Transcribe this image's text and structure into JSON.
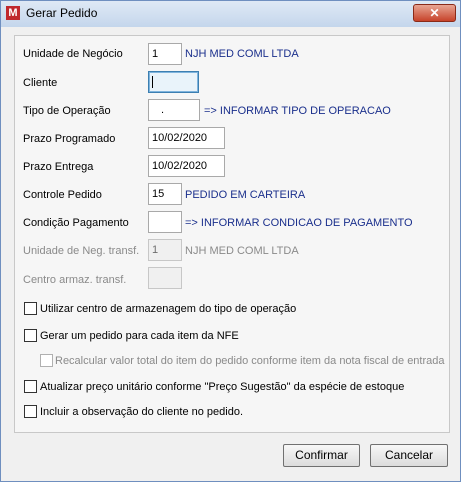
{
  "window": {
    "title": "Gerar Pedido",
    "close_symbol": "✕"
  },
  "fields": [
    {
      "label": "Unidade de Negócio",
      "value": "1",
      "info": "NJH MED COML LTDA"
    },
    {
      "label": "Cliente",
      "value": ""
    },
    {
      "label": "Tipo de Operação",
      "value": ".",
      "info": "=> INFORMAR TIPO DE OPERACAO"
    },
    {
      "label": "Prazo Programado",
      "value": "10/02/2020"
    },
    {
      "label": "Prazo Entrega",
      "value": "10/02/2020"
    },
    {
      "label": "Controle Pedido",
      "value": "15",
      "info": "PEDIDO EM CARTEIRA"
    },
    {
      "label": "Condição Pagamento",
      "value": "",
      "info": "=> INFORMAR CONDICAO DE PAGAMENTO"
    },
    {
      "label": "Unidade de Neg. transf.",
      "value": "1",
      "info": "NJH MED COML LTDA"
    },
    {
      "label": "Centro armaz. transf.",
      "value": ""
    }
  ],
  "options": [
    {
      "label": "Utilizar centro de armazenagem do tipo de operação",
      "checked": false
    },
    {
      "label": "Gerar um pedido para cada item da NFE",
      "checked": false
    },
    {
      "label": "Recalcular valor total do item do pedido conforme item da nota fiscal de entrada",
      "checked": false
    },
    {
      "label": "Atualizar preço unitário conforme \"Preço Sugestão\" da espécie de estoque",
      "checked": false
    },
    {
      "label": "Incluir a observação do cliente no pedido.",
      "checked": false
    }
  ],
  "buttons": {
    "confirm": "Confirmar",
    "cancel": "Cancelar"
  }
}
